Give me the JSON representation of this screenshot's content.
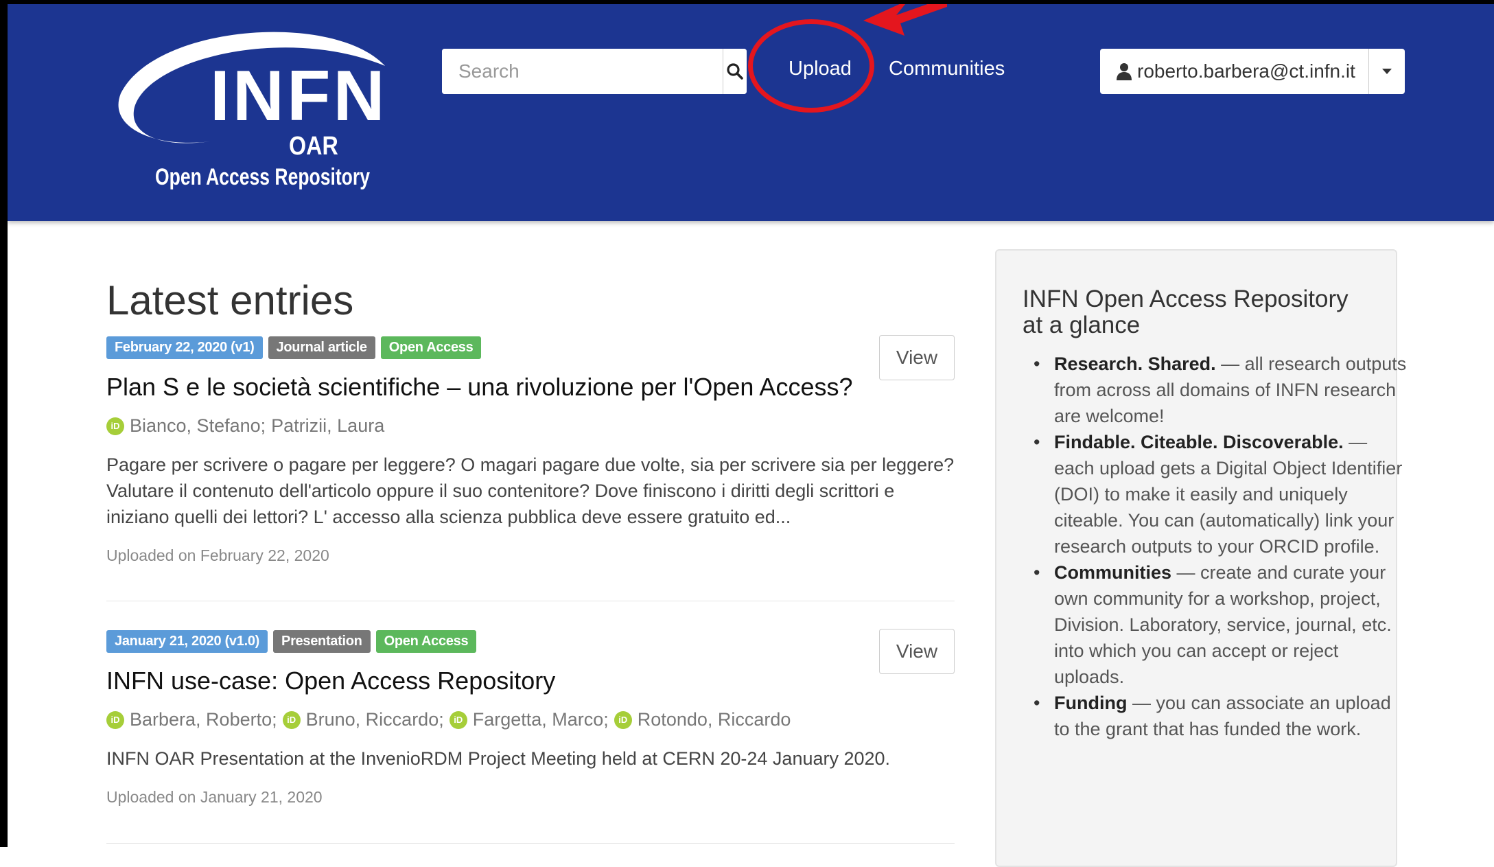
{
  "header": {
    "logo_main": "INFN",
    "logo_short": "OAR",
    "logo_sub": "Open Access Repository",
    "search_placeholder": "Search",
    "nav": {
      "upload": "Upload",
      "communities": "Communities"
    },
    "user_email": "roberto.barbera@ct.infn.it",
    "brand_color": "#1c3591",
    "highlight_color": "#e4161e"
  },
  "main": {
    "title": "Latest entries",
    "view_label": "View",
    "entries": [
      {
        "date_badge": "February 22, 2020 (v1)",
        "type_badge": "Journal article",
        "access_badge": "Open Access",
        "title": "Plan S e le società scientifiche – una rivoluzione per l'Open Access?",
        "authors": [
          "Bianco, Stefano;",
          "Patrizii, Laura"
        ],
        "description_lines": [
          "Pagare per scrivere o pagare per leggere? O magari pagare due volte, sia per scrivere sia per leggere?",
          "Valutare il contenuto dell'articolo oppure il suo contenitore? Dove finiscono i diritti degli scrittori e",
          "iniziano quelli dei lettori? L' accesso alla scienza pubblica deve essere gratuito ed..."
        ],
        "uploaded": "Uploaded on February 22, 2020"
      },
      {
        "date_badge": "January 21, 2020 (v1.0)",
        "type_badge": "Presentation",
        "access_badge": "Open Access",
        "title": "INFN use-case: Open Access Repository",
        "authors": [
          "Barbera, Roberto;",
          "Bruno, Riccardo;",
          "Fargetta, Marco;",
          "Rotondo, Riccardo"
        ],
        "description_lines": [
          "INFN OAR Presentation at the InvenioRDM Project Meeting held at CERN 20-24 January 2020."
        ],
        "uploaded": "Uploaded on January 21, 2020"
      }
    ]
  },
  "sidebar": {
    "title_line1": "INFN Open Access Repository",
    "title_line2": "at a glance",
    "items": [
      {
        "heading": "Research. Shared.",
        "text": " — all research outputs from across all domains of INFN research are welcome!"
      },
      {
        "heading": "Findable. Citeable. Discoverable.",
        "text": " — each upload gets a Digital Object Identifier (DOI) to make it easily and uniquely citeable. You can (automatically) link your research outputs to your ORCID profile."
      },
      {
        "heading": "Communities",
        "text": " — create and curate your own community for a workshop, project, Division. Laboratory, service, journal, etc. into which you can accept or reject uploads."
      },
      {
        "heading": "Funding",
        "text": " — you can associate an upload to the grant that has funded the work."
      }
    ]
  }
}
